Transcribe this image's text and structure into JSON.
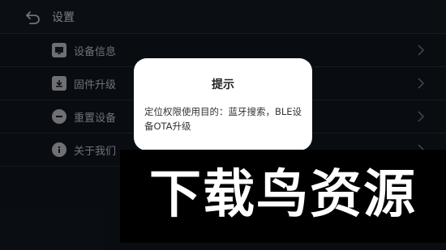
{
  "header": {
    "title": "设置",
    "back_icon": "back-arrow-icon"
  },
  "menu": {
    "items": [
      {
        "label": "设备信息",
        "icon": "device-info-icon"
      },
      {
        "label": "固件升级",
        "icon": "firmware-upgrade-icon"
      },
      {
        "label": "重置设备",
        "icon": "reset-device-icon"
      },
      {
        "label": "关于我们",
        "icon": "info-icon"
      }
    ]
  },
  "dialog": {
    "title": "提示",
    "message": "定位权限使用目的：蓝牙搜索，BLE设备OTA升级"
  },
  "watermark": {
    "text": "下载鸟资源"
  },
  "colors": {
    "background": "#121821",
    "dialog": "#ffffff",
    "watermark_bg": "#000000"
  }
}
